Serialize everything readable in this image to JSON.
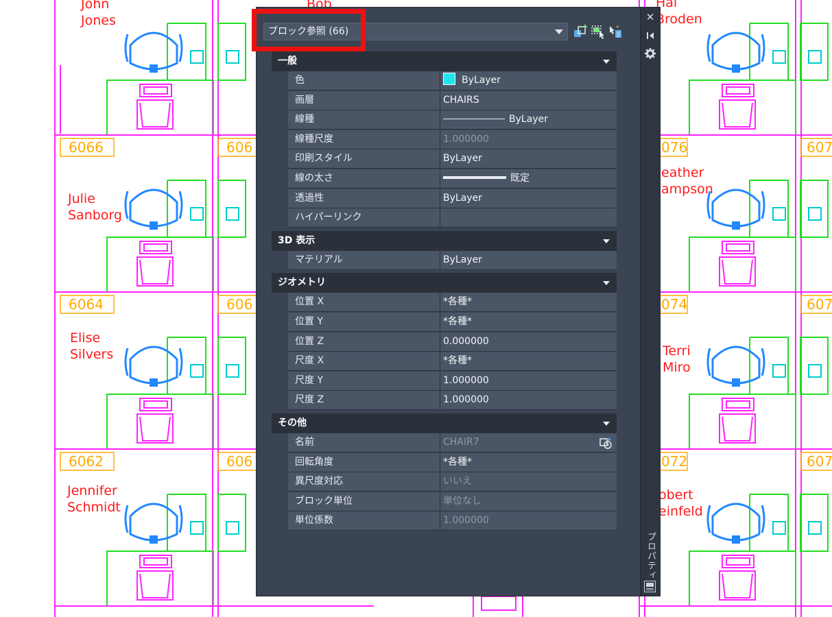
{
  "palette": {
    "selector": "ブロック参照 (66)",
    "side_title": "プロパティ",
    "close_glyph": "✕",
    "sections": [
      {
        "title": "一般",
        "rows": [
          {
            "label": "色",
            "value": "ByLayer"
          },
          {
            "label": "画層",
            "value": "CHAIRS"
          },
          {
            "label": "線種",
            "value": "ByLayer"
          },
          {
            "label": "線種尺度",
            "value": "1.000000"
          },
          {
            "label": "印刷スタイル",
            "value": "ByLayer"
          },
          {
            "label": "線の太さ",
            "value": "既定"
          },
          {
            "label": "透過性",
            "value": "ByLayer"
          },
          {
            "label": "ハイパーリンク",
            "value": ""
          }
        ]
      },
      {
        "title": "3D 表示",
        "rows": [
          {
            "label": "マテリアル",
            "value": "ByLayer"
          }
        ]
      },
      {
        "title": "ジオメトリ",
        "rows": [
          {
            "label": "位置 X",
            "value": "*各種*"
          },
          {
            "label": "位置 Y",
            "value": "*各種*"
          },
          {
            "label": "位置 Z",
            "value": "0.000000"
          },
          {
            "label": "尺度 X",
            "value": "*各種*"
          },
          {
            "label": "尺度 Y",
            "value": "1.000000"
          },
          {
            "label": "尺度 Z",
            "value": "1.000000"
          }
        ]
      },
      {
        "title": "その他",
        "rows": [
          {
            "label": "名前",
            "value": "CHAIR7"
          },
          {
            "label": "回転角度",
            "value": "*各種*"
          },
          {
            "label": "異尺度対応",
            "value": "いいえ"
          },
          {
            "label": "ブロック単位",
            "value": "単位なし"
          },
          {
            "label": "単位係数",
            "value": "1.000000"
          }
        ]
      }
    ]
  },
  "drawing": {
    "names": {
      "john_1": "John",
      "john_2": "Jones",
      "bob": "Bob",
      "hal_1": "Hal",
      "hal_2": "Broden",
      "julie_1": "Julie",
      "julie_2": "Sanborg",
      "heather_1": "eather",
      "heather_2": "ampson",
      "elise_1": "Elise",
      "elise_2": "Silvers",
      "terri_1": "Terri",
      "terri_2": "Miro",
      "jennifer_1": "Jennifer",
      "jennifer_2": "Schmidt",
      "robert_1": "obert",
      "robert_2": "einfeld"
    },
    "rooms": {
      "r6066": "6066",
      "r606a": "606",
      "r076": "076",
      "r607a": "607",
      "r6064": "6064",
      "r606b": "606",
      "r074": "074",
      "r607b": "607",
      "r6062": "6062",
      "r606c": "606",
      "r072": "072",
      "r607c": "607"
    },
    "colors": {
      "name_text": "#ff1a1a",
      "room_tag": "#ffaa00",
      "partitions": "#ff22ff",
      "furniture": "#22dd22",
      "chairs": "#2288ff",
      "phones": "#00cccc"
    }
  }
}
